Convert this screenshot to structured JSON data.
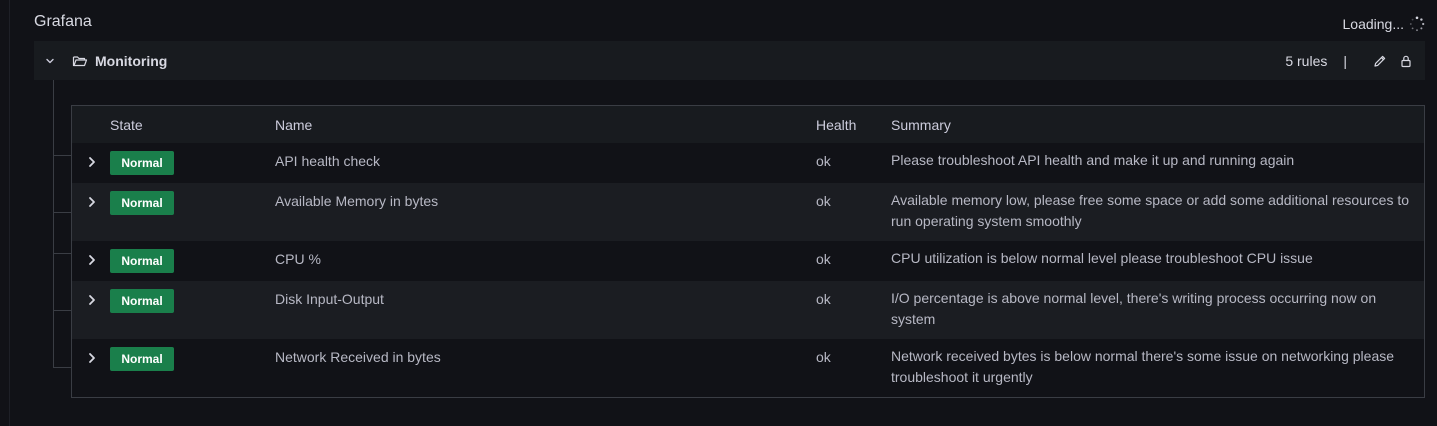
{
  "app": {
    "title": "Grafana",
    "loading_text": "Loading..."
  },
  "folder": {
    "name": "Monitoring",
    "rule_count": "5 rules",
    "separator": "|",
    "icons": {
      "toggle": "chevron-down-icon",
      "folder": "folder-open-icon",
      "edit": "pencil-icon",
      "permissions": "lock-icon"
    }
  },
  "table": {
    "headers": {
      "state": "State",
      "name": "Name",
      "health": "Health",
      "summary": "Summary"
    },
    "rows": [
      {
        "state": "Normal",
        "name": "API health check",
        "health": "ok",
        "summary": "Please troubleshoot API health and make it up and running again"
      },
      {
        "state": "Normal",
        "name": "Available Memory in bytes",
        "health": "ok",
        "summary": "Available memory low, please free some space or add some additional resources to run operating system smoothly"
      },
      {
        "state": "Normal",
        "name": "CPU %",
        "health": "ok",
        "summary": "CPU utilization is below normal level please troubleshoot CPU issue"
      },
      {
        "state": "Normal",
        "name": "Disk Input-Output",
        "health": "ok",
        "summary": "I/O percentage is above normal level, there's writing process occurring now on system"
      },
      {
        "state": "Normal",
        "name": "Network Received in bytes",
        "health": "ok",
        "summary": "Network received bytes is below normal there's some issue on networking please troubleshoot it urgently"
      }
    ]
  },
  "colors": {
    "background": "#111217",
    "panel": "#181b1f",
    "normal_badge": "#1a7f4b",
    "border": "#3a3d44"
  }
}
